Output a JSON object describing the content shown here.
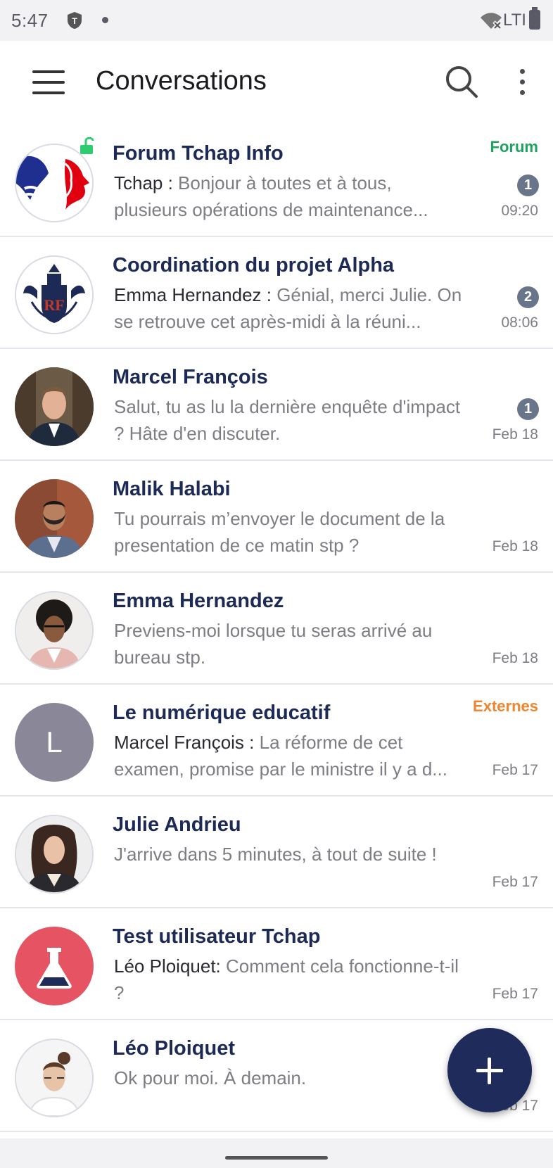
{
  "status_bar": {
    "time": "5:47",
    "network": "LTI",
    "app_icon": "tchap-shield-icon",
    "wifi_icon": "wifi-off-icon",
    "battery_icon": "battery-icon"
  },
  "app_bar": {
    "title": "Conversations",
    "menu_icon": "hamburger-menu-icon",
    "search_icon": "search-icon",
    "overflow_icon": "more-vertical-icon"
  },
  "rooms": [
    {
      "name": "Forum Tchap Info",
      "sender": "Tchap :",
      "message": " Bonjour à toutes et à tous, plusieurs opérations de maintenance...",
      "time": "09:20",
      "badge": "1",
      "tag": "Forum",
      "tag_color": "#1ea35f"
    },
    {
      "name": "Coordination du projet Alpha",
      "sender": "Emma Hernandez :",
      "message": " Génial, merci Julie. On se retrouve cet après-midi à la réuni...",
      "time": "08:06",
      "badge": "2"
    },
    {
      "name": "Marcel François",
      "message": "Salut, tu as lu la dernière enquête d'impact ? Hâte d'en discuter.",
      "time": "Feb 18",
      "badge": "1"
    },
    {
      "name": "Malik Halabi",
      "message": "Tu pourrais m’envoyer le document de la presentation de ce matin stp ?",
      "time": "Feb 18"
    },
    {
      "name": "Emma Hernandez",
      "message": "Previens-moi lorsque tu seras arrivé au bureau stp.",
      "time": "Feb 18"
    },
    {
      "name": "Le numérique educatif",
      "sender": "Marcel François :",
      "message": " La réforme de cet examen, promise par le ministre il y a d...",
      "time": "Feb 17",
      "tag": "Externes",
      "tag_color": "#f0842f",
      "avatar_initial": "L",
      "avatar_color": "#8a8799"
    },
    {
      "name": "Julie Andrieu",
      "message": "J'arrive dans 5 minutes, à tout de suite !",
      "time": "Feb 17"
    },
    {
      "name": "Test utilisateur Tchap",
      "sender": "Léo Ploiquet:",
      "message": " Comment cela fonctionne-t-il ?",
      "time": "Feb 17",
      "avatar_color": "#e65363",
      "avatar_icon": "flask-icon"
    },
    {
      "name": "Léo Ploiquet",
      "message": "Ok pour moi. À demain.",
      "time": "Feb 17"
    }
  ],
  "fab": {
    "icon": "plus-icon"
  }
}
